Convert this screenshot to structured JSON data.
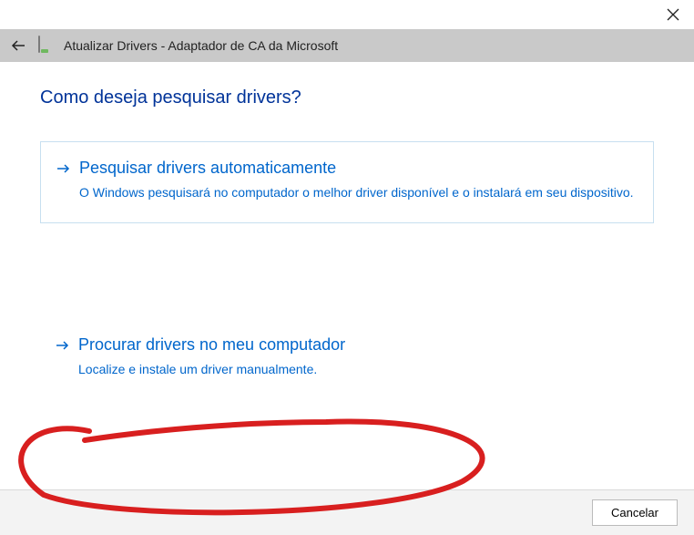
{
  "header": {
    "title": "Atualizar Drivers - Adaptador de CA da Microsoft"
  },
  "question": "Como deseja pesquisar drivers?",
  "options": {
    "auto": {
      "title": "Pesquisar drivers automaticamente",
      "desc": "O Windows pesquisará no computador o melhor driver disponível e o instalará em seu dispositivo."
    },
    "browse": {
      "title": "Procurar drivers no meu computador",
      "desc": "Localize e instale um driver manualmente."
    }
  },
  "footer": {
    "cancel_label": "Cancelar"
  }
}
